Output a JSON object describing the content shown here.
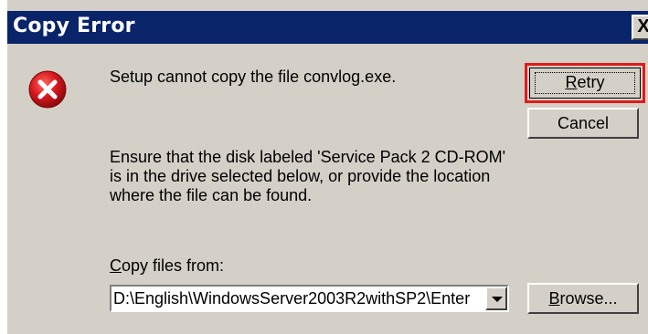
{
  "window": {
    "title": "Copy Error",
    "close_label": "X"
  },
  "icons": {
    "error": "error-circle-icon",
    "close": "close-icon",
    "dropdown": "chevron-down-icon"
  },
  "dialog": {
    "message": "Setup cannot copy the file convlog.exe.",
    "instructions_line1": "Ensure that the disk labeled 'Service Pack 2 CD-ROM'",
    "instructions_line2": "is in the drive selected below, or provide the location",
    "instructions_line3": "where the file can be found.",
    "copy_from_label_accel": "C",
    "copy_from_label_rest": "opy files from:",
    "copy_from_value": "D:\\English\\WindowsServer2003R2withSP2\\Enter"
  },
  "buttons": {
    "retry_accel": "R",
    "retry_rest": "etry",
    "cancel": "Cancel",
    "browse_accel": "B",
    "browse_rest": "rowse..."
  },
  "colors": {
    "title_bar": "#0a246a",
    "dialog_bg": "#d4d0c8",
    "highlight": "#e01b1b",
    "error_red": "#d7181e"
  }
}
